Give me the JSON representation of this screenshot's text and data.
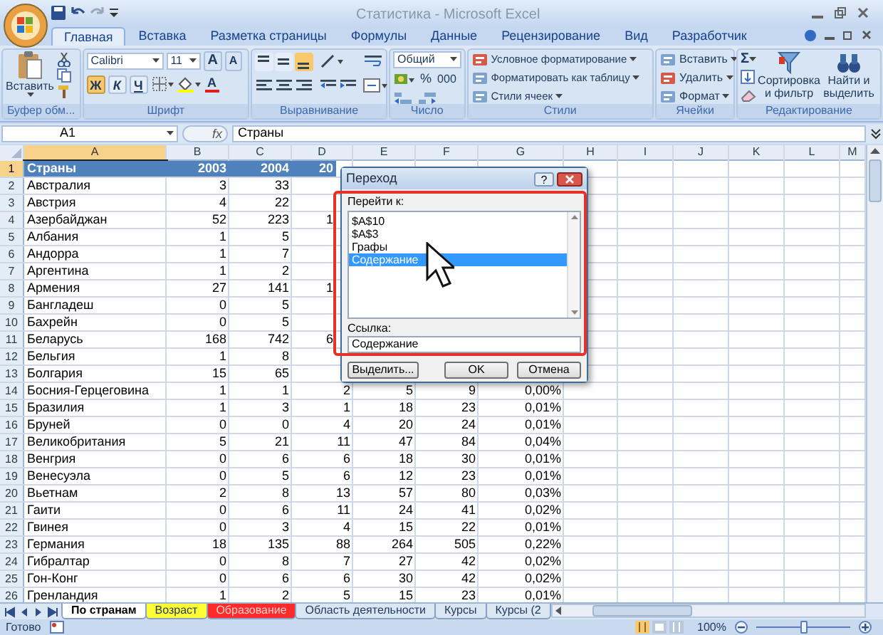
{
  "window": {
    "title": "Статистика - Microsoft Excel"
  },
  "ribbon_tabs": [
    {
      "label": "Главная",
      "selected": true
    },
    {
      "label": "Вставка",
      "selected": false
    },
    {
      "label": "Разметка страницы",
      "selected": false
    },
    {
      "label": "Формулы",
      "selected": false
    },
    {
      "label": "Данные",
      "selected": false
    },
    {
      "label": "Рецензирование",
      "selected": false
    },
    {
      "label": "Вид",
      "selected": false
    },
    {
      "label": "Разработчик",
      "selected": false
    }
  ],
  "clipboard": {
    "label": "Буфер обм...",
    "paste": "Вставить"
  },
  "font": {
    "label": "Шрифт",
    "font_name": "Calibri",
    "font_size": "11",
    "grow": "A",
    "shrink": "A",
    "font_color": "A",
    "styles": [
      {
        "label": "Ж",
        "on": true
      },
      {
        "label": "К",
        "on": false
      },
      {
        "label": "Ч",
        "on": false
      }
    ]
  },
  "alignment": {
    "label": "Выравнивание",
    "vertical": [
      {
        "kind": "top",
        "on": false
      },
      {
        "kind": "middle",
        "on": false
      },
      {
        "kind": "bottom",
        "on": true
      }
    ]
  },
  "number": {
    "label": "Число",
    "format": "Общий",
    "percent": "%",
    "thousands": "000"
  },
  "styles": {
    "label": "Стили",
    "commands": [
      "Условное форматирование",
      "Форматировать как таблицу",
      "Стили ячеек"
    ]
  },
  "cells": {
    "label": "Ячейки",
    "commands": [
      "Вставить",
      "Удалить",
      "Формат"
    ]
  },
  "editing": {
    "label": "Редактирование",
    "sum": "Σ",
    "commands": [
      "Сортировка и фильтр",
      "Найти и выделить"
    ]
  },
  "formula_bar": {
    "name_box": "A1",
    "fx": "fx",
    "value": "Страны"
  },
  "columns": [
    {
      "label": "A",
      "selected": true
    },
    {
      "label": "B",
      "selected": false
    },
    {
      "label": "C",
      "selected": false
    },
    {
      "label": "D",
      "selected": false
    },
    {
      "label": "E",
      "selected": false
    },
    {
      "label": "F",
      "selected": false
    },
    {
      "label": "G",
      "selected": false
    },
    {
      "label": "H",
      "selected": false
    },
    {
      "label": "I",
      "selected": false
    },
    {
      "label": "J",
      "selected": false
    },
    {
      "label": "K",
      "selected": false
    },
    {
      "label": "L",
      "selected": false
    },
    {
      "label": "M",
      "selected": false
    }
  ],
  "rows": [
    {
      "number": "1",
      "kind": "header",
      "selected": true,
      "a": "Страны",
      "b": "2003",
      "c": "2004",
      "d": "20"
    },
    {
      "number": "2",
      "kind": "data",
      "selected": false,
      "a": "Австралия",
      "b": "3",
      "c": "33"
    },
    {
      "number": "3",
      "kind": "data",
      "selected": false,
      "a": "Австрия",
      "b": "4",
      "c": "22"
    },
    {
      "number": "4",
      "kind": "data",
      "selected": false,
      "a": "Азербайджан",
      "b": "52",
      "c": "223",
      "d": "1"
    },
    {
      "number": "5",
      "kind": "data",
      "selected": false,
      "a": "Албания",
      "b": "1",
      "c": "5"
    },
    {
      "number": "6",
      "kind": "data",
      "selected": false,
      "a": "Андорра",
      "b": "1",
      "c": "7"
    },
    {
      "number": "7",
      "kind": "data",
      "selected": false,
      "a": "Аргентина",
      "b": "1",
      "c": "2"
    },
    {
      "number": "8",
      "kind": "data",
      "selected": false,
      "a": "Армения",
      "b": "27",
      "c": "141",
      "d": "1"
    },
    {
      "number": "9",
      "kind": "data",
      "selected": false,
      "a": "Бангладеш",
      "b": "0",
      "c": "5"
    },
    {
      "number": "10",
      "kind": "data",
      "selected": false,
      "a": "Бахрейн",
      "b": "0",
      "c": "5"
    },
    {
      "number": "11",
      "kind": "data",
      "selected": false,
      "a": "Беларусь",
      "b": "168",
      "c": "742",
      "d": "6"
    },
    {
      "number": "12",
      "kind": "data",
      "selected": false,
      "a": "Бельгия",
      "b": "1",
      "c": "8"
    },
    {
      "number": "13",
      "kind": "data",
      "selected": false,
      "a": "Болгария",
      "b": "15",
      "c": "65"
    },
    {
      "number": "14",
      "kind": "data",
      "selected": false,
      "a": "Босния-Герцеговина",
      "b": "1",
      "c": "1",
      "d": "2",
      "e": "5",
      "f": "9",
      "g": "0,00%"
    },
    {
      "number": "15",
      "kind": "data",
      "selected": false,
      "a": "Бразилия",
      "b": "1",
      "c": "3",
      "d": "1",
      "e": "18",
      "f": "23",
      "g": "0,01%"
    },
    {
      "number": "16",
      "kind": "data",
      "selected": false,
      "a": "Бруней",
      "b": "0",
      "c": "0",
      "d": "4",
      "e": "20",
      "f": "24",
      "g": "0,01%"
    },
    {
      "number": "17",
      "kind": "data",
      "selected": false,
      "a": "Великобритания",
      "b": "5",
      "c": "21",
      "d": "11",
      "e": "47",
      "f": "84",
      "g": "0,04%"
    },
    {
      "number": "18",
      "kind": "data",
      "selected": false,
      "a": "Венгрия",
      "b": "0",
      "c": "6",
      "d": "6",
      "e": "18",
      "f": "30",
      "g": "0,01%"
    },
    {
      "number": "19",
      "kind": "data",
      "selected": false,
      "a": "Венесуэла",
      "b": "0",
      "c": "5",
      "d": "6",
      "e": "12",
      "f": "23",
      "g": "0,01%"
    },
    {
      "number": "20",
      "kind": "data",
      "selected": false,
      "a": "Вьетнам",
      "b": "2",
      "c": "8",
      "d": "13",
      "e": "57",
      "f": "80",
      "g": "0,03%"
    },
    {
      "number": "21",
      "kind": "data",
      "selected": false,
      "a": "Гаити",
      "b": "0",
      "c": "6",
      "d": "11",
      "e": "24",
      "f": "41",
      "g": "0,02%"
    },
    {
      "number": "22",
      "kind": "data",
      "selected": false,
      "a": "Гвинея",
      "b": "0",
      "c": "3",
      "d": "4",
      "e": "15",
      "f": "22",
      "g": "0,01%"
    },
    {
      "number": "23",
      "kind": "data",
      "selected": false,
      "a": "Германия",
      "b": "18",
      "c": "135",
      "d": "88",
      "e": "264",
      "f": "505",
      "g": "0,22%"
    },
    {
      "number": "24",
      "kind": "data",
      "selected": false,
      "a": "Гибралтар",
      "b": "0",
      "c": "8",
      "d": "7",
      "e": "27",
      "f": "42",
      "g": "0,02%"
    },
    {
      "number": "25",
      "kind": "data",
      "selected": false,
      "a": "Гон-Конг",
      "b": "0",
      "c": "6",
      "d": "6",
      "e": "30",
      "f": "42",
      "g": "0,02%"
    },
    {
      "number": "26",
      "kind": "data",
      "selected": false,
      "a": "Гренландия",
      "b": "1",
      "c": "2",
      "d": "5",
      "e": "15",
      "f": "23",
      "g": "0,01%"
    }
  ],
  "dialog": {
    "title": "Переход",
    "help": "?",
    "goto_label": "Перейти к:",
    "items": [
      {
        "label": "$A$10",
        "selected": false
      },
      {
        "label": "$A$3",
        "selected": false
      },
      {
        "label": "Графы",
        "selected": false
      },
      {
        "label": "Содержание",
        "selected": true
      }
    ],
    "reference_label": "Ссылка:",
    "reference_value": "Содержание",
    "buttons": [
      "Выделить...",
      "OK",
      "Отмена"
    ]
  },
  "sheet_tabs": [
    {
      "label": "По странам",
      "selected": true
    },
    {
      "label": "Возраст",
      "selected": false,
      "color": "#ffff33"
    },
    {
      "label": "Образование",
      "selected": false,
      "color": "#ff2a2a"
    },
    {
      "label": "Область деятельности",
      "selected": false
    },
    {
      "label": "Курсы",
      "selected": false
    },
    {
      "label": "Курсы (2",
      "selected": false
    }
  ],
  "status_bar": {
    "status": "Готово",
    "zoom": "100%",
    "zoom_slider": {
      "level": 0.5
    }
  }
}
